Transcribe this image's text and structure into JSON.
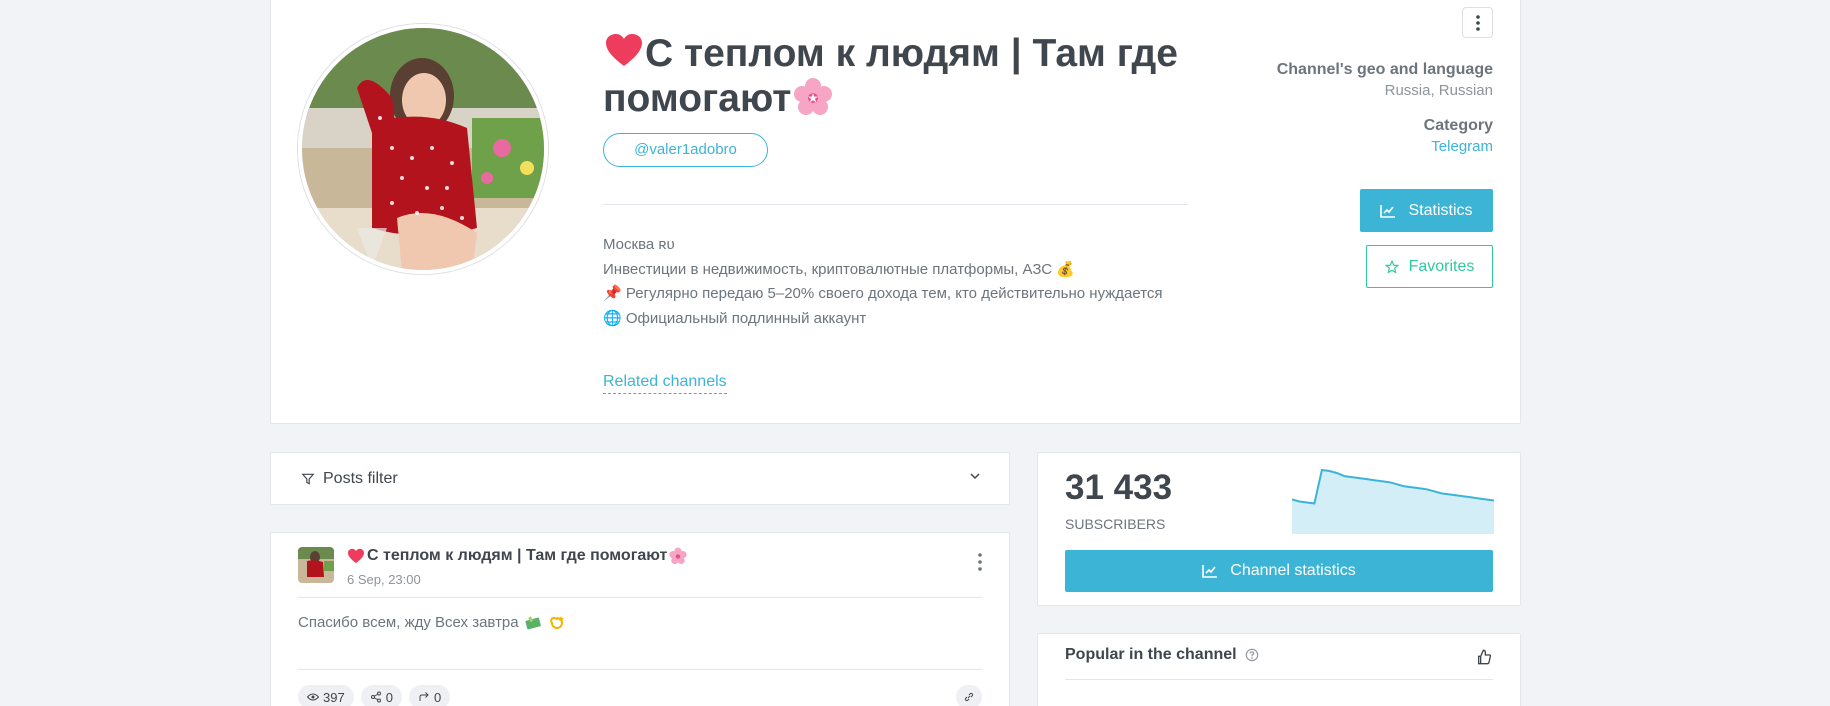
{
  "channel": {
    "title": "С теплом к людям | Там где помогают",
    "handle": "@valer1adobro",
    "description": [
      "Москва ʀᴜ",
      "Инвестиции в недвижимость, криптовалютные платформы, АЗС 💰",
      "📌 Регулярно передаю 5–20% своего дохода тем, кто действительно нуждается",
      "🌐 Официальный подлинный аккаунт"
    ],
    "related_label": "Related channels",
    "geo_label": "Channel's geo and language",
    "geo_value": "Russia, Russian",
    "category_label": "Category",
    "category_value": "Telegram",
    "statistics_button": "Statistics",
    "favorites_button": "Favorites"
  },
  "filter": {
    "label": "Posts filter"
  },
  "post": {
    "title": "С теплом к людям | Там где помогают",
    "date": "6 Sep, 23:00",
    "text": "Спасибо всем, жду Всех завтра",
    "views": "397",
    "shares": "0",
    "forwards": "0"
  },
  "subscribers": {
    "count": "31 433",
    "label": "SUBSCRIBERS",
    "button": "Channel statistics",
    "trend": [
      32,
      30,
      29,
      28,
      61,
      60,
      58,
      55,
      54,
      53,
      52,
      51,
      50,
      49,
      47,
      45,
      44,
      43,
      42,
      40,
      38,
      37,
      36,
      35,
      34,
      33,
      32,
      31
    ]
  },
  "popular": {
    "title": "Popular in the channel"
  },
  "colors": {
    "accent": "#3cb4d6",
    "favorite": "#30c8a0",
    "text_dark": "#3f464d"
  }
}
